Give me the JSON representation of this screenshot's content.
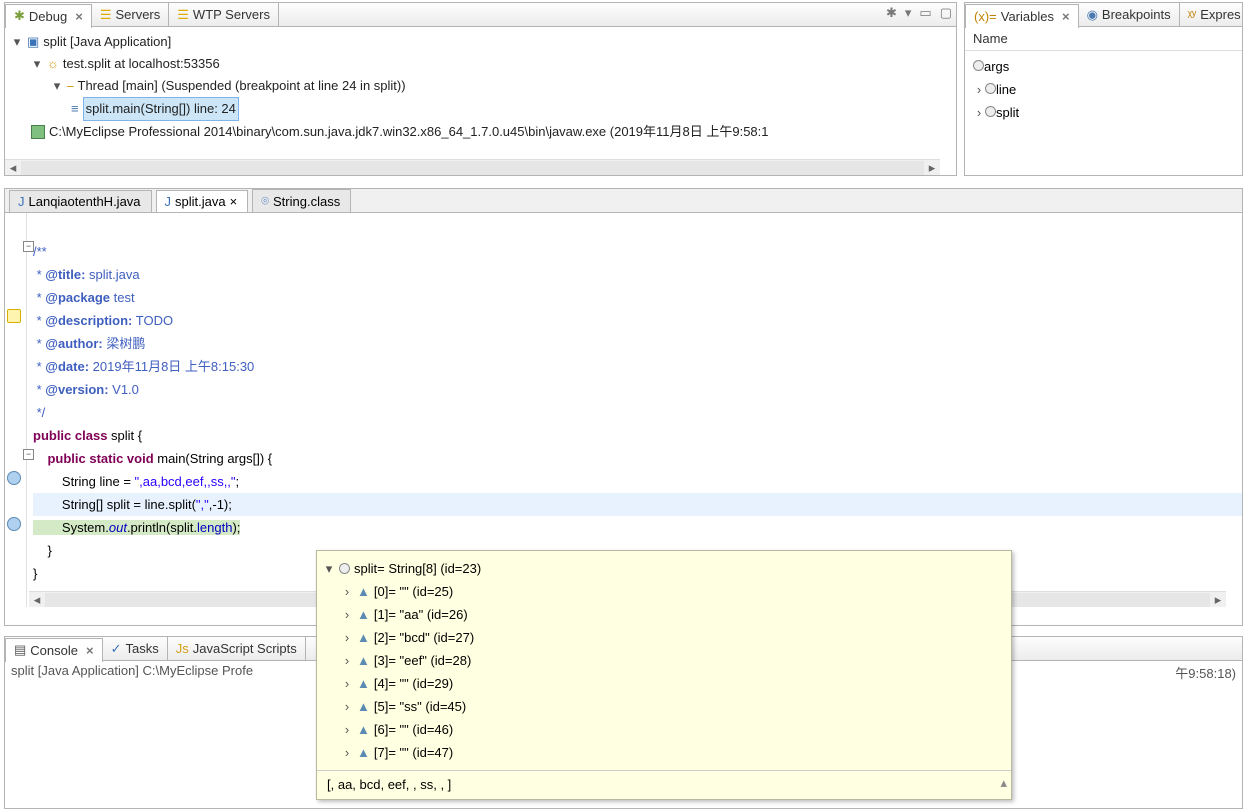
{
  "debug_pane": {
    "tabs": [
      {
        "label": "Debug",
        "active": true
      },
      {
        "label": "Servers",
        "active": false
      },
      {
        "label": "WTP Servers",
        "active": false
      }
    ],
    "tree": {
      "app": "split [Java Application]",
      "target": "test.split at localhost:53356",
      "thread": "Thread [main] (Suspended (breakpoint at line 24 in split))",
      "frame": "split.main(String[]) line: 24",
      "process": "C:\\MyEclipse Professional 2014\\binary\\com.sun.java.jdk7.win32.x86_64_1.7.0.u45\\bin\\javaw.exe (2019年11月8日 上午9:58:1"
    }
  },
  "vars_pane": {
    "tabs": [
      {
        "label": "Variables",
        "active": true
      },
      {
        "label": "Breakpoints"
      },
      {
        "label": "Expres"
      }
    ],
    "header": "Name",
    "items": [
      {
        "name": "args",
        "kind": "leaf"
      },
      {
        "name": "line",
        "kind": "exp"
      },
      {
        "name": "split",
        "kind": "exp"
      }
    ]
  },
  "editor": {
    "tabs": [
      {
        "label": "LanqiaotenthH.java"
      },
      {
        "label": "split.java",
        "active": true,
        "dirty": false
      },
      {
        "label": "String.class"
      }
    ],
    "comment": {
      "open": "/**",
      "l1": " * @title: split.java",
      "l2": " * @package test",
      "l3": " * @description: TODO",
      "l4": " * @author: 梁树鹏",
      "l5": " * @date: 2019年11月8日 上午8:15:30",
      "l6": " * @version: V1.0",
      "close": " */"
    },
    "code": {
      "cls_pre": "public class ",
      "cls_name": "split {",
      "m_pre": "    public static void ",
      "m_sig": "main(String args[]) {",
      "l1_a": "        String line = ",
      "l1_s": "\",aa,bcd,eef,,ss,,\"",
      "l1_b": ";",
      "l2_a": "        String[] split = line.split(",
      "l2_s": "\",\"",
      "l2_b": ",-1);",
      "l3_a": "        System.",
      "l3_out": "out",
      "l3_b": ".println(split.",
      "l3_len": "length",
      "l3_c": ");",
      "cb1": "    }",
      "cb2": "}"
    }
  },
  "hover": {
    "root": "split= String[8]  (id=23)",
    "items": [
      "[0]= \"\" (id=25)",
      "[1]= \"aa\" (id=26)",
      "[2]= \"bcd\" (id=27)",
      "[3]= \"eef\" (id=28)",
      "[4]= \"\" (id=29)",
      "[5]= \"ss\" (id=45)",
      "[6]= \"\" (id=46)",
      "[7]= \"\" (id=47)"
    ],
    "tostring": "[, aa, bcd, eef, , ss, , ]"
  },
  "console": {
    "tabs": [
      {
        "label": "Console",
        "active": true
      },
      {
        "label": "Tasks"
      },
      {
        "label": "JavaScript Scripts"
      }
    ],
    "title_a": "split [Java Application] C:\\MyEclipse Profe",
    "title_b": "午9:58:18)"
  }
}
